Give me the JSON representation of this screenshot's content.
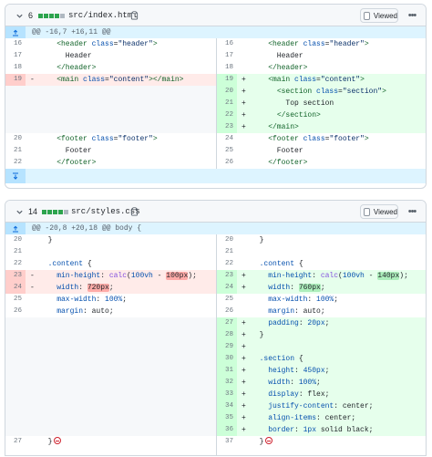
{
  "files": [
    {
      "count": "6",
      "blocks": [
        "green",
        "green",
        "green",
        "green",
        "gray"
      ],
      "name": "src/index.html",
      "viewed_label": "Viewed",
      "hunk": "@@ -16,7 +16,11 @@",
      "left": [
        {
          "n": "16",
          "sign": "",
          "type": "ctx",
          "tokens": [
            [
              "",
              "    "
            ],
            [
              "t",
              "<header"
            ],
            [
              "",
              " "
            ],
            [
              "a",
              "class"
            ],
            [
              "",
              "="
            ],
            [
              "s",
              "\"header\""
            ],
            [
              "t",
              ">"
            ]
          ]
        },
        {
          "n": "17",
          "sign": "",
          "type": "ctx",
          "tokens": [
            [
              "",
              "      Header"
            ]
          ]
        },
        {
          "n": "18",
          "sign": "",
          "type": "ctx",
          "tokens": [
            [
              "",
              "    "
            ],
            [
              "t",
              "</header>"
            ]
          ]
        },
        {
          "n": "19",
          "sign": "-",
          "type": "del",
          "tokens": [
            [
              "",
              "    "
            ],
            [
              "t",
              "<main"
            ],
            [
              "",
              " "
            ],
            [
              "a",
              "class"
            ],
            [
              "",
              "="
            ],
            [
              "s",
              "\"content\""
            ],
            [
              "t",
              "></main>"
            ]
          ]
        },
        {
          "n": "",
          "sign": "",
          "type": "empty",
          "tokens": []
        },
        {
          "n": "",
          "sign": "",
          "type": "empty",
          "tokens": []
        },
        {
          "n": "",
          "sign": "",
          "type": "empty",
          "tokens": []
        },
        {
          "n": "",
          "sign": "",
          "type": "empty",
          "tokens": []
        },
        {
          "n": "20",
          "sign": "",
          "type": "ctx",
          "tokens": [
            [
              "",
              "    "
            ],
            [
              "t",
              "<footer"
            ],
            [
              "",
              " "
            ],
            [
              "a",
              "class"
            ],
            [
              "",
              "="
            ],
            [
              "s",
              "\"footer\""
            ],
            [
              "t",
              ">"
            ]
          ]
        },
        {
          "n": "21",
          "sign": "",
          "type": "ctx",
          "tokens": [
            [
              "",
              "      Footer"
            ]
          ]
        },
        {
          "n": "22",
          "sign": "",
          "type": "ctx",
          "tokens": [
            [
              "",
              "    "
            ],
            [
              "t",
              "</footer>"
            ]
          ]
        }
      ],
      "right": [
        {
          "n": "16",
          "sign": "",
          "type": "ctx",
          "tokens": [
            [
              "",
              "    "
            ],
            [
              "t",
              "<header"
            ],
            [
              "",
              " "
            ],
            [
              "a",
              "class"
            ],
            [
              "",
              "="
            ],
            [
              "s",
              "\"header\""
            ],
            [
              "t",
              ">"
            ]
          ]
        },
        {
          "n": "17",
          "sign": "",
          "type": "ctx",
          "tokens": [
            [
              "",
              "      Header"
            ]
          ]
        },
        {
          "n": "18",
          "sign": "",
          "type": "ctx",
          "tokens": [
            [
              "",
              "    "
            ],
            [
              "t",
              "</header>"
            ]
          ]
        },
        {
          "n": "19",
          "sign": "+",
          "type": "add",
          "tokens": [
            [
              "",
              "    "
            ],
            [
              "t",
              "<main"
            ],
            [
              "",
              " "
            ],
            [
              "a",
              "class"
            ],
            [
              "",
              "="
            ],
            [
              "s",
              "\"content\""
            ],
            [
              "t",
              ">"
            ]
          ]
        },
        {
          "n": "20",
          "sign": "+",
          "type": "add",
          "tokens": [
            [
              "",
              "      "
            ],
            [
              "t",
              "<section"
            ],
            [
              "",
              " "
            ],
            [
              "a",
              "class"
            ],
            [
              "",
              "="
            ],
            [
              "s",
              "\"section\""
            ],
            [
              "t",
              ">"
            ]
          ]
        },
        {
          "n": "21",
          "sign": "+",
          "type": "add",
          "tokens": [
            [
              "",
              "        Top section"
            ]
          ]
        },
        {
          "n": "22",
          "sign": "+",
          "type": "add",
          "tokens": [
            [
              "",
              "      "
            ],
            [
              "t",
              "</section>"
            ]
          ]
        },
        {
          "n": "23",
          "sign": "+",
          "type": "add",
          "tokens": [
            [
              "",
              "    "
            ],
            [
              "t",
              "</main>"
            ]
          ]
        },
        {
          "n": "24",
          "sign": "",
          "type": "ctx",
          "tokens": [
            [
              "",
              "    "
            ],
            [
              "t",
              "<footer"
            ],
            [
              "",
              " "
            ],
            [
              "a",
              "class"
            ],
            [
              "",
              "="
            ],
            [
              "s",
              "\"footer\""
            ],
            [
              "t",
              ">"
            ]
          ]
        },
        {
          "n": "25",
          "sign": "",
          "type": "ctx",
          "tokens": [
            [
              "",
              "      Footer"
            ]
          ]
        },
        {
          "n": "26",
          "sign": "",
          "type": "ctx",
          "tokens": [
            [
              "",
              "    "
            ],
            [
              "t",
              "</footer>"
            ]
          ]
        }
      ]
    },
    {
      "count": "14",
      "blocks": [
        "green",
        "green",
        "green",
        "green",
        "gray"
      ],
      "name": "src/styles.css",
      "viewed_label": "Viewed",
      "hunk": "@@ -20,8 +20,18 @@ body {",
      "left": [
        {
          "n": "20",
          "sign": "",
          "type": "ctx",
          "tokens": [
            [
              "",
              "  }"
            ]
          ]
        },
        {
          "n": "21",
          "sign": "",
          "type": "ctx",
          "tokens": []
        },
        {
          "n": "22",
          "sign": "",
          "type": "ctx",
          "tokens": [
            [
              "",
              "  "
            ],
            [
              "a",
              ".content"
            ],
            [
              "",
              " {"
            ]
          ]
        },
        {
          "n": "23",
          "sign": "-",
          "type": "del",
          "tokens": [
            [
              "",
              "    "
            ],
            [
              "p",
              "min-height"
            ],
            [
              "",
              ": "
            ],
            [
              "f",
              "calc"
            ],
            [
              "",
              "("
            ],
            [
              "p",
              "100vh"
            ],
            [
              "",
              " - "
            ],
            [
              "hd",
              "100px"
            ],
            [
              "",
              ");"
            ]
          ]
        },
        {
          "n": "24",
          "sign": "-",
          "type": "del",
          "tokens": [
            [
              "",
              "    "
            ],
            [
              "p",
              "width"
            ],
            [
              "",
              ": "
            ],
            [
              "hd",
              "720px"
            ],
            [
              "",
              ";"
            ]
          ]
        },
        {
          "n": "25",
          "sign": "",
          "type": "ctx",
          "tokens": [
            [
              "",
              "    "
            ],
            [
              "p",
              "max-width"
            ],
            [
              "",
              ": "
            ],
            [
              "p",
              "100%"
            ],
            [
              "",
              ";"
            ]
          ]
        },
        {
          "n": "26",
          "sign": "",
          "type": "ctx",
          "tokens": [
            [
              "",
              "    "
            ],
            [
              "p",
              "margin"
            ],
            [
              "",
              ": auto;"
            ]
          ]
        },
        {
          "n": "",
          "sign": "",
          "type": "empty",
          "tokens": []
        },
        {
          "n": "",
          "sign": "",
          "type": "empty",
          "tokens": []
        },
        {
          "n": "",
          "sign": "",
          "type": "empty",
          "tokens": []
        },
        {
          "n": "",
          "sign": "",
          "type": "empty",
          "tokens": []
        },
        {
          "n": "",
          "sign": "",
          "type": "empty",
          "tokens": []
        },
        {
          "n": "",
          "sign": "",
          "type": "empty",
          "tokens": []
        },
        {
          "n": "",
          "sign": "",
          "type": "empty",
          "tokens": []
        },
        {
          "n": "",
          "sign": "",
          "type": "empty",
          "tokens": []
        },
        {
          "n": "",
          "sign": "",
          "type": "empty",
          "tokens": []
        },
        {
          "n": "",
          "sign": "",
          "type": "empty",
          "tokens": []
        },
        {
          "n": "27",
          "sign": "",
          "type": "ctx",
          "nonl": true,
          "tokens": [
            [
              "",
              "  }"
            ]
          ]
        }
      ],
      "right": [
        {
          "n": "20",
          "sign": "",
          "type": "ctx",
          "tokens": [
            [
              "",
              "  }"
            ]
          ]
        },
        {
          "n": "21",
          "sign": "",
          "type": "ctx",
          "tokens": []
        },
        {
          "n": "22",
          "sign": "",
          "type": "ctx",
          "tokens": [
            [
              "",
              "  "
            ],
            [
              "a",
              ".content"
            ],
            [
              "",
              " {"
            ]
          ]
        },
        {
          "n": "23",
          "sign": "+",
          "type": "add",
          "tokens": [
            [
              "",
              "    "
            ],
            [
              "p",
              "min-height"
            ],
            [
              "",
              ": "
            ],
            [
              "f",
              "calc"
            ],
            [
              "",
              "("
            ],
            [
              "p",
              "100vh"
            ],
            [
              "",
              " - "
            ],
            [
              "ha",
              "140px"
            ],
            [
              "",
              ");"
            ]
          ]
        },
        {
          "n": "24",
          "sign": "+",
          "type": "add",
          "tokens": [
            [
              "",
              "    "
            ],
            [
              "p",
              "width"
            ],
            [
              "",
              ": "
            ],
            [
              "ha",
              "760px"
            ],
            [
              "",
              ";"
            ]
          ]
        },
        {
          "n": "25",
          "sign": "",
          "type": "ctx",
          "tokens": [
            [
              "",
              "    "
            ],
            [
              "p",
              "max-width"
            ],
            [
              "",
              ": "
            ],
            [
              "p",
              "100%"
            ],
            [
              "",
              ";"
            ]
          ]
        },
        {
          "n": "26",
          "sign": "",
          "type": "ctx",
          "tokens": [
            [
              "",
              "    "
            ],
            [
              "p",
              "margin"
            ],
            [
              "",
              ": auto;"
            ]
          ]
        },
        {
          "n": "27",
          "sign": "+",
          "type": "add",
          "tokens": [
            [
              "",
              "    "
            ],
            [
              "p",
              "padding"
            ],
            [
              "",
              ": "
            ],
            [
              "p",
              "20px"
            ],
            [
              "",
              ";"
            ]
          ]
        },
        {
          "n": "28",
          "sign": "+",
          "type": "add",
          "tokens": [
            [
              "",
              "  }"
            ]
          ]
        },
        {
          "n": "29",
          "sign": "+",
          "type": "add",
          "tokens": []
        },
        {
          "n": "30",
          "sign": "+",
          "type": "add",
          "tokens": [
            [
              "",
              "  "
            ],
            [
              "a",
              ".section"
            ],
            [
              "",
              " {"
            ]
          ]
        },
        {
          "n": "31",
          "sign": "+",
          "type": "add",
          "tokens": [
            [
              "",
              "    "
            ],
            [
              "p",
              "height"
            ],
            [
              "",
              ": "
            ],
            [
              "p",
              "450px"
            ],
            [
              "",
              ";"
            ]
          ]
        },
        {
          "n": "32",
          "sign": "+",
          "type": "add",
          "tokens": [
            [
              "",
              "    "
            ],
            [
              "p",
              "width"
            ],
            [
              "",
              ": "
            ],
            [
              "p",
              "100%"
            ],
            [
              "",
              ";"
            ]
          ]
        },
        {
          "n": "33",
          "sign": "+",
          "type": "add",
          "tokens": [
            [
              "",
              "    "
            ],
            [
              "p",
              "display"
            ],
            [
              "",
              ": flex;"
            ]
          ]
        },
        {
          "n": "34",
          "sign": "+",
          "type": "add",
          "tokens": [
            [
              "",
              "    "
            ],
            [
              "p",
              "justify-content"
            ],
            [
              "",
              ": center;"
            ]
          ]
        },
        {
          "n": "35",
          "sign": "+",
          "type": "add",
          "tokens": [
            [
              "",
              "    "
            ],
            [
              "p",
              "align-items"
            ],
            [
              "",
              ": center;"
            ]
          ]
        },
        {
          "n": "36",
          "sign": "+",
          "type": "add",
          "tokens": [
            [
              "",
              "    "
            ],
            [
              "p",
              "border"
            ],
            [
              "",
              ": "
            ],
            [
              "p",
              "1px"
            ],
            [
              "",
              " solid black;"
            ]
          ]
        },
        {
          "n": "37",
          "sign": "",
          "type": "ctx",
          "nonl": true,
          "tokens": [
            [
              "",
              "  }"
            ]
          ]
        }
      ]
    }
  ],
  "icons": {
    "chevron": "chevron-down-icon",
    "copy": "copy-icon",
    "expand_up": "expand-up-icon",
    "expand_down": "expand-down-icon",
    "more": "kebab-horizontal-icon",
    "no_newline": "no-newline-icon"
  },
  "colors": {
    "added_bg": "#e6ffec",
    "added_num_bg": "#ccffd8",
    "deleted_bg": "#ffebe9",
    "deleted_num_bg": "#ffcecb",
    "hunk_bg": "#ddf4ff",
    "blocks_green": "#2da44e",
    "blocks_gray": "#afb8c1"
  }
}
